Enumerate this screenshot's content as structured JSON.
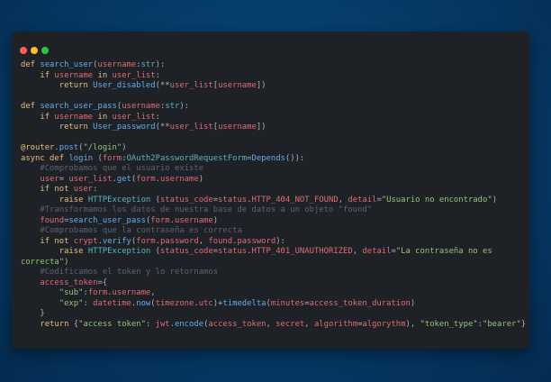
{
  "window": {
    "controls": [
      "close",
      "minimize",
      "maximize"
    ]
  },
  "code_lines": [
    [
      {
        "t": "def ",
        "c": "kw"
      },
      {
        "t": "search_user",
        "c": "fn"
      },
      {
        "t": "(",
        "c": "tx"
      },
      {
        "t": "username",
        "c": "pm"
      },
      {
        "t": ":",
        "c": "tx"
      },
      {
        "t": "str",
        "c": "ty"
      },
      {
        "t": "):",
        "c": "tx"
      }
    ],
    [
      {
        "t": "    ",
        "c": "tx"
      },
      {
        "t": "if ",
        "c": "kw"
      },
      {
        "t": "username ",
        "c": "pm"
      },
      {
        "t": "in ",
        "c": "kw"
      },
      {
        "t": "user_list",
        "c": "pm"
      },
      {
        "t": ":",
        "c": "tx"
      }
    ],
    [
      {
        "t": "        ",
        "c": "tx"
      },
      {
        "t": "return ",
        "c": "kw"
      },
      {
        "t": "User_disabled",
        "c": "fn"
      },
      {
        "t": "(**",
        "c": "tx"
      },
      {
        "t": "user_list",
        "c": "pm"
      },
      {
        "t": "[",
        "c": "tx"
      },
      {
        "t": "username",
        "c": "pm"
      },
      {
        "t": "])",
        "c": "tx"
      }
    ],
    [],
    [
      {
        "t": "def ",
        "c": "kw"
      },
      {
        "t": "search_user_pass",
        "c": "fn"
      },
      {
        "t": "(",
        "c": "tx"
      },
      {
        "t": "username",
        "c": "pm"
      },
      {
        "t": ":",
        "c": "tx"
      },
      {
        "t": "str",
        "c": "ty"
      },
      {
        "t": "):",
        "c": "tx"
      }
    ],
    [
      {
        "t": "    ",
        "c": "tx"
      },
      {
        "t": "if ",
        "c": "kw"
      },
      {
        "t": "username ",
        "c": "pm"
      },
      {
        "t": "in ",
        "c": "kw"
      },
      {
        "t": "user_list",
        "c": "pm"
      },
      {
        "t": ":",
        "c": "tx"
      }
    ],
    [
      {
        "t": "        ",
        "c": "tx"
      },
      {
        "t": "return ",
        "c": "kw"
      },
      {
        "t": "User_password",
        "c": "fn"
      },
      {
        "t": "(**",
        "c": "tx"
      },
      {
        "t": "user_list",
        "c": "pm"
      },
      {
        "t": "[",
        "c": "tx"
      },
      {
        "t": "username",
        "c": "pm"
      },
      {
        "t": "])",
        "c": "tx"
      }
    ],
    [],
    [
      {
        "t": "@router",
        "c": "kw"
      },
      {
        "t": ".",
        "c": "tx"
      },
      {
        "t": "post",
        "c": "fn"
      },
      {
        "t": "(",
        "c": "tx"
      },
      {
        "t": "\"/login\"",
        "c": "st"
      },
      {
        "t": ")",
        "c": "tx"
      }
    ],
    [
      {
        "t": "async def ",
        "c": "kw"
      },
      {
        "t": "login ",
        "c": "fn"
      },
      {
        "t": "(",
        "c": "tx"
      },
      {
        "t": "form",
        "c": "pm"
      },
      {
        "t": ":",
        "c": "tx"
      },
      {
        "t": "OAuth2PasswordRequestForm",
        "c": "ty"
      },
      {
        "t": "=",
        "c": "tx"
      },
      {
        "t": "Depends",
        "c": "fn"
      },
      {
        "t": "()):",
        "c": "tx"
      }
    ],
    [
      {
        "t": "    ",
        "c": "tx"
      },
      {
        "t": "#Comprobamos que el usuario existe",
        "c": "cm"
      }
    ],
    [
      {
        "t": "    ",
        "c": "tx"
      },
      {
        "t": "user",
        "c": "pm"
      },
      {
        "t": "= ",
        "c": "tx"
      },
      {
        "t": "user_list",
        "c": "pm"
      },
      {
        "t": ".",
        "c": "tx"
      },
      {
        "t": "get",
        "c": "fn"
      },
      {
        "t": "(",
        "c": "tx"
      },
      {
        "t": "form",
        "c": "pm"
      },
      {
        "t": ".",
        "c": "tx"
      },
      {
        "t": "username",
        "c": "pm"
      },
      {
        "t": ")",
        "c": "tx"
      }
    ],
    [
      {
        "t": "    ",
        "c": "tx"
      },
      {
        "t": "if not ",
        "c": "kw"
      },
      {
        "t": "user",
        "c": "pm"
      },
      {
        "t": ":",
        "c": "tx"
      }
    ],
    [
      {
        "t": "        ",
        "c": "tx"
      },
      {
        "t": "raise ",
        "c": "kw"
      },
      {
        "t": "HTTPException ",
        "c": "ty"
      },
      {
        "t": "(",
        "c": "tx"
      },
      {
        "t": "status_code",
        "c": "pm"
      },
      {
        "t": "=",
        "c": "tx"
      },
      {
        "t": "status",
        "c": "pm"
      },
      {
        "t": ".",
        "c": "tx"
      },
      {
        "t": "HTTP_404_NOT_FOUND",
        "c": "pm"
      },
      {
        "t": ", ",
        "c": "tx"
      },
      {
        "t": "detail",
        "c": "pm"
      },
      {
        "t": "=",
        "c": "tx"
      },
      {
        "t": "\"Usuario no encontrado\"",
        "c": "st"
      },
      {
        "t": ")",
        "c": "tx"
      }
    ],
    [
      {
        "t": "    ",
        "c": "tx"
      },
      {
        "t": "#Transformamos los datos de nuestra base de datos a un objeto \"found\"",
        "c": "cm"
      }
    ],
    [
      {
        "t": "    ",
        "c": "tx"
      },
      {
        "t": "found",
        "c": "pm"
      },
      {
        "t": "=",
        "c": "tx"
      },
      {
        "t": "search_user_pass",
        "c": "fn"
      },
      {
        "t": "(",
        "c": "tx"
      },
      {
        "t": "form",
        "c": "pm"
      },
      {
        "t": ".",
        "c": "tx"
      },
      {
        "t": "username",
        "c": "pm"
      },
      {
        "t": ")",
        "c": "tx"
      }
    ],
    [
      {
        "t": "    ",
        "c": "tx"
      },
      {
        "t": "#Comprobamos que la contraseña es correcta",
        "c": "cm"
      }
    ],
    [
      {
        "t": "    ",
        "c": "tx"
      },
      {
        "t": "if not ",
        "c": "kw"
      },
      {
        "t": "crypt",
        "c": "pm"
      },
      {
        "t": ".",
        "c": "tx"
      },
      {
        "t": "verify",
        "c": "fn"
      },
      {
        "t": "(",
        "c": "tx"
      },
      {
        "t": "form",
        "c": "pm"
      },
      {
        "t": ".",
        "c": "tx"
      },
      {
        "t": "password",
        "c": "pm"
      },
      {
        "t": ", ",
        "c": "tx"
      },
      {
        "t": "found",
        "c": "pm"
      },
      {
        "t": ".",
        "c": "tx"
      },
      {
        "t": "password",
        "c": "pm"
      },
      {
        "t": "):",
        "c": "tx"
      }
    ],
    [
      {
        "t": "        ",
        "c": "tx"
      },
      {
        "t": "raise ",
        "c": "kw"
      },
      {
        "t": "HTTPException ",
        "c": "ty"
      },
      {
        "t": "(",
        "c": "tx"
      },
      {
        "t": "status_code",
        "c": "pm"
      },
      {
        "t": "=",
        "c": "tx"
      },
      {
        "t": "status",
        "c": "pm"
      },
      {
        "t": ".",
        "c": "tx"
      },
      {
        "t": "HTTP_401_UNAUTHORIZED",
        "c": "pm"
      },
      {
        "t": ", ",
        "c": "tx"
      },
      {
        "t": "detail",
        "c": "pm"
      },
      {
        "t": "=",
        "c": "tx"
      },
      {
        "t": "\"La contraseña no es",
        "c": "st"
      }
    ],
    [
      {
        "t": "correcta\"",
        "c": "st"
      },
      {
        "t": ")",
        "c": "tx"
      }
    ],
    [
      {
        "t": "    ",
        "c": "tx"
      },
      {
        "t": "#Codificamos el token y lo retornamos",
        "c": "cm"
      }
    ],
    [
      {
        "t": "    ",
        "c": "tx"
      },
      {
        "t": "access_token",
        "c": "pm"
      },
      {
        "t": "={",
        "c": "tx"
      }
    ],
    [
      {
        "t": "        ",
        "c": "tx"
      },
      {
        "t": "\"sub\"",
        "c": "st"
      },
      {
        "t": ":",
        "c": "tx"
      },
      {
        "t": "form",
        "c": "pm"
      },
      {
        "t": ".",
        "c": "tx"
      },
      {
        "t": "username",
        "c": "pm"
      },
      {
        "t": ",",
        "c": "tx"
      }
    ],
    [
      {
        "t": "        ",
        "c": "tx"
      },
      {
        "t": "\"exp\"",
        "c": "st"
      },
      {
        "t": ": ",
        "c": "tx"
      },
      {
        "t": "datetime",
        "c": "pm"
      },
      {
        "t": ".",
        "c": "tx"
      },
      {
        "t": "now",
        "c": "fn"
      },
      {
        "t": "(",
        "c": "tx"
      },
      {
        "t": "timezone",
        "c": "pm"
      },
      {
        "t": ".",
        "c": "tx"
      },
      {
        "t": "utc",
        "c": "pm"
      },
      {
        "t": ")+",
        "c": "tx"
      },
      {
        "t": "timedelta",
        "c": "fn"
      },
      {
        "t": "(",
        "c": "tx"
      },
      {
        "t": "minutes",
        "c": "pm"
      },
      {
        "t": "=",
        "c": "tx"
      },
      {
        "t": "access_token_duration",
        "c": "pm"
      },
      {
        "t": ")",
        "c": "tx"
      }
    ],
    [
      {
        "t": "    }",
        "c": "tx"
      }
    ],
    [
      {
        "t": "    ",
        "c": "tx"
      },
      {
        "t": "return ",
        "c": "kw"
      },
      {
        "t": "{",
        "c": "tx"
      },
      {
        "t": "\"access token\"",
        "c": "st"
      },
      {
        "t": ": ",
        "c": "tx"
      },
      {
        "t": "jwt",
        "c": "pm"
      },
      {
        "t": ".",
        "c": "tx"
      },
      {
        "t": "encode",
        "c": "fn"
      },
      {
        "t": "(",
        "c": "tx"
      },
      {
        "t": "access_token",
        "c": "pm"
      },
      {
        "t": ", ",
        "c": "tx"
      },
      {
        "t": "secret",
        "c": "pm"
      },
      {
        "t": ", ",
        "c": "tx"
      },
      {
        "t": "algorithm",
        "c": "pm"
      },
      {
        "t": "=",
        "c": "tx"
      },
      {
        "t": "algorythm",
        "c": "pm"
      },
      {
        "t": "), ",
        "c": "tx"
      },
      {
        "t": "\"token_type\"",
        "c": "st"
      },
      {
        "t": ":",
        "c": "tx"
      },
      {
        "t": "\"bearer\"",
        "c": "st"
      },
      {
        "t": "}",
        "c": "tx"
      }
    ]
  ]
}
